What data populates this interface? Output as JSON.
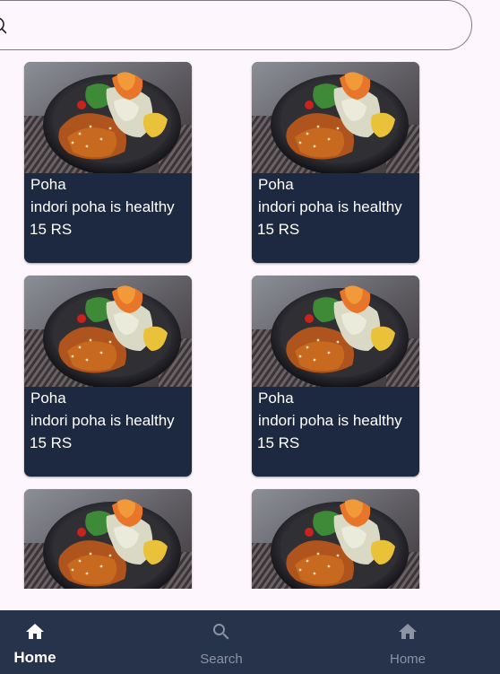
{
  "search": {
    "placeholder": ""
  },
  "items": [
    {
      "name": "Poha",
      "description": "indori poha is healthy",
      "price": "15 RS"
    },
    {
      "name": "Poha",
      "description": "indori poha is healthy",
      "price": "15 RS"
    },
    {
      "name": "Poha",
      "description": "indori poha is healthy",
      "price": "15 RS"
    },
    {
      "name": "Poha",
      "description": "indori poha is healthy",
      "price": "15 RS"
    },
    {
      "name": "",
      "description": "",
      "price": ""
    },
    {
      "name": "",
      "description": "",
      "price": ""
    }
  ],
  "bottom_nav": {
    "items": [
      {
        "label": "Home",
        "icon": "home-icon",
        "active": true
      },
      {
        "label": "Search",
        "icon": "search-icon",
        "active": false
      },
      {
        "label": "Home",
        "icon": "home-icon",
        "active": false
      }
    ]
  },
  "colors": {
    "background": "#fdf7fd",
    "card": "#1d2841",
    "nav": "#27324b",
    "nav_active": "#ffffff",
    "nav_inactive": "#8c93a3"
  }
}
